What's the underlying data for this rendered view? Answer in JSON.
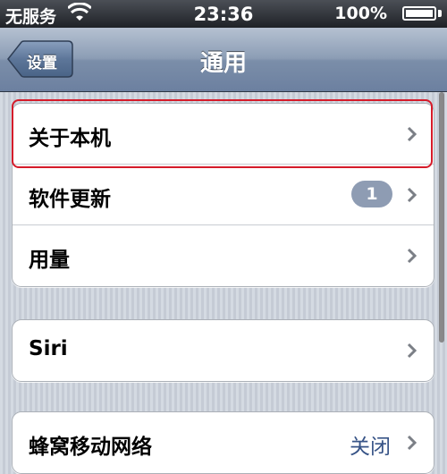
{
  "status_bar": {
    "carrier": "无服务",
    "time": "23:36",
    "battery": "100%",
    "wifi_icon": "wifi-icon",
    "battery_icon": "battery-icon"
  },
  "nav": {
    "back_label": "设置",
    "title": "通用"
  },
  "groups": [
    {
      "rows": [
        {
          "label": "关于本机",
          "icon": "chevron-right-icon"
        },
        {
          "label": "软件更新",
          "badge": "1",
          "icon": "chevron-right-icon"
        },
        {
          "label": "用量",
          "icon": "chevron-right-icon"
        }
      ]
    },
    {
      "rows": [
        {
          "label": "Siri",
          "icon": "chevron-right-icon"
        }
      ]
    },
    {
      "rows": [
        {
          "label": "蜂窝移动网络",
          "value": "关闭",
          "icon": "chevron-right-icon"
        }
      ]
    }
  ],
  "colors": {
    "highlight": "#d51b2a",
    "badge": "#8e9cb3",
    "value_text": "#385487"
  }
}
